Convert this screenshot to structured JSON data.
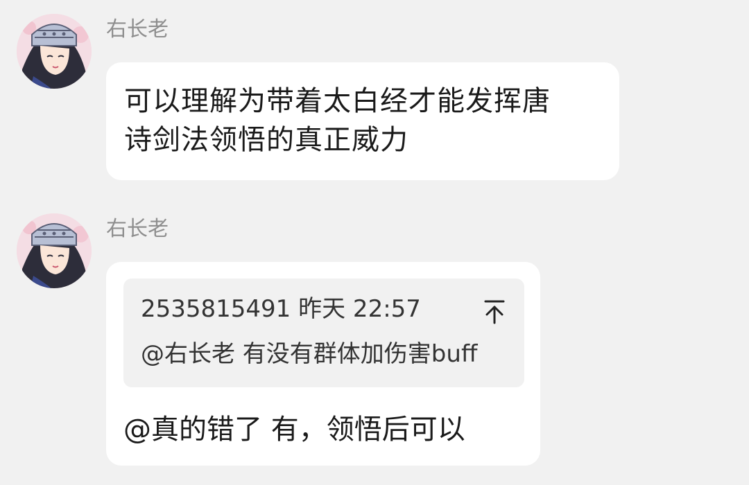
{
  "messages": [
    {
      "sender": "右长老",
      "lines": [
        "可以理解为带着太白经才能发挥唐",
        "诗剑法领悟的真正威力"
      ]
    },
    {
      "sender": "右长老",
      "quote": {
        "meta": "2535815491 昨天 22:57",
        "body": "@右长老 有没有群体加伤害buff",
        "jump_icon": "jump-to-top-icon"
      },
      "text": "@真的错了 有，领悟后可以"
    }
  ],
  "colors": {
    "background": "#f1f1f1",
    "bubble": "#ffffff",
    "sender_name": "#8e8e8e",
    "quote_background": "#f1f1f1"
  },
  "icons": {
    "avatar": "anime-girl-avatar"
  }
}
